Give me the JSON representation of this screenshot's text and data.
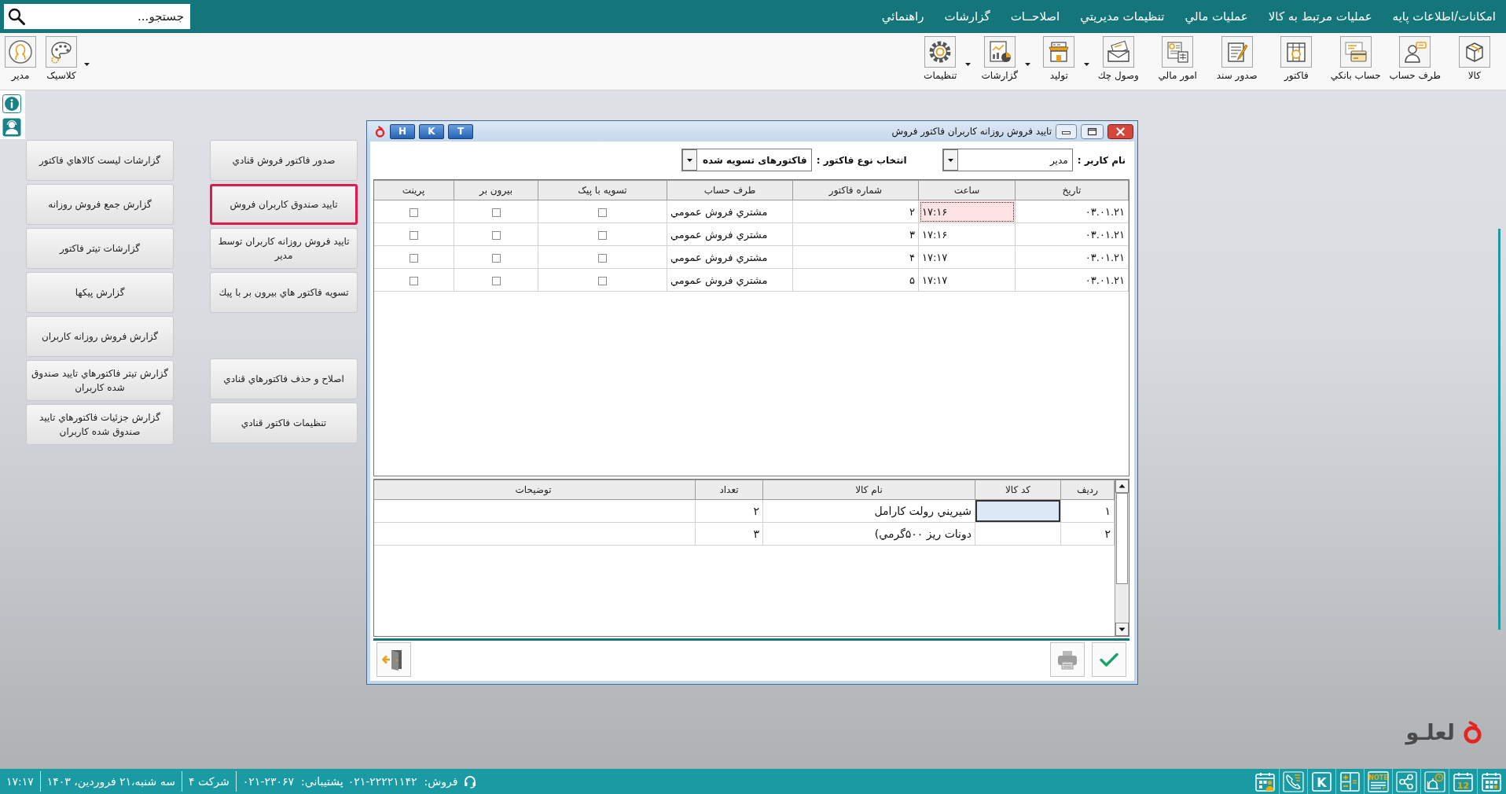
{
  "menu_bar": {
    "items": [
      {
        "label": "امکانات/اطلاعات پايه"
      },
      {
        "label": "عمليات مرتبط به کالا"
      },
      {
        "label": "عمليات مالي"
      },
      {
        "label": "تنظيمات مديريتي"
      },
      {
        "label": "اصلاحــات"
      },
      {
        "label": "گزارشات"
      },
      {
        "label": "راهنمائي"
      }
    ],
    "search": {
      "placeholder": "جستجو..."
    }
  },
  "toolbar": {
    "items": [
      {
        "label": "کالا",
        "dropdown": false
      },
      {
        "label": "طرف حساب",
        "dropdown": false
      },
      {
        "label": "حساب بانکي",
        "dropdown": false
      },
      {
        "label": "فاکتور",
        "dropdown": false
      },
      {
        "label": "صدور سند",
        "dropdown": false
      },
      {
        "label": "امور مالي",
        "dropdown": false
      },
      {
        "label": "وصول چك",
        "dropdown": false
      },
      {
        "label": "توليد",
        "dropdown": true
      },
      {
        "label": "گزارشات",
        "dropdown": true
      },
      {
        "label": "تنظيمات",
        "dropdown": true
      }
    ],
    "user_items": [
      {
        "label": "کلاسيک",
        "dropdown": true
      },
      {
        "label": "مدير",
        "dropdown": false
      }
    ]
  },
  "action_panel": {
    "columns": [
      {
        "groups": [
          [
            {
              "label": "صدور فاکتور فروش قنادي",
              "selected": false
            },
            {
              "label": "تاييد صندوق کاربران فروش",
              "selected": true
            },
            {
              "label": "تاييد فروش روزانه کاربران توسط مدير",
              "selected": false
            },
            {
              "label": "تسويه فاکتور هاي بيرون بر با پيك",
              "selected": false
            }
          ],
          [
            {
              "label": "اصلاح و حذف فاکتورهاي قنادي",
              "selected": false
            },
            {
              "label": "تنظيمات فاکتور قنادي",
              "selected": false
            }
          ]
        ]
      },
      {
        "groups": [
          [
            {
              "label": "گزارشات ليست کالاهاي فاکتور",
              "selected": false
            },
            {
              "label": "گزارش جمع فروش روزانه",
              "selected": false
            },
            {
              "label": "گزارشات تيتر فاکتور",
              "selected": false
            },
            {
              "label": "گزارش پيکها",
              "selected": false
            },
            {
              "label": "گزارش فروش روزانه کاربران",
              "selected": false
            },
            {
              "label": "گزارش تيتر فاکتورهاي تاييد صندوق شده کاربران",
              "selected": false
            },
            {
              "label": "گزارش جزئيات فاکتورهاي تاييد صندوق شده کاربران",
              "selected": false
            }
          ]
        ]
      }
    ]
  },
  "dialog": {
    "title": "تاييد فروش روزانه کاربران فاکتور فروش",
    "title_buttons": [
      {
        "label": "T"
      },
      {
        "label": "K"
      },
      {
        "label": "H"
      }
    ],
    "filters": [
      {
        "label": "نام کاربر :",
        "value": "مدير"
      },
      {
        "label": "انتخاب نوع فاکتور :",
        "value": "فاکتورهای تسويه شده"
      }
    ],
    "invoices": {
      "columns": [
        "تاريخ",
        "ساعت",
        "شماره فاکتور",
        "طرف حساب",
        "تسويه با پيک",
        "بيرون بر",
        "پرينت"
      ],
      "rows": [
        {
          "date": "۰۳.۰۱.۲۱",
          "time": "۱۷:۱۶",
          "number": "۲",
          "account": "مشتري فروش عمومي",
          "courier_settled": false,
          "takeaway": false,
          "print": false,
          "selected": true
        },
        {
          "date": "۰۳.۰۱.۲۱",
          "time": "۱۷:۱۶",
          "number": "۳",
          "account": "مشتري فروش عمومي",
          "courier_settled": false,
          "takeaway": false,
          "print": false,
          "selected": false
        },
        {
          "date": "۰۳.۰۱.۲۱",
          "time": "۱۷:۱۷",
          "number": "۴",
          "account": "مشتري فروش عمومي",
          "courier_settled": false,
          "takeaway": false,
          "print": false,
          "selected": false
        },
        {
          "date": "۰۳.۰۱.۲۱",
          "time": "۱۷:۱۷",
          "number": "۵",
          "account": "مشتري فروش عمومي",
          "courier_settled": false,
          "takeaway": false,
          "print": false,
          "selected": false
        }
      ]
    },
    "items": {
      "columns": [
        "رديف",
        "کد کالا",
        "نام کالا",
        "تعداد",
        "توضيحات"
      ],
      "rows": [
        {
          "row_no": "۱",
          "name": "شيريني رولت کارامل",
          "qty": "۲",
          "selected": true
        },
        {
          "row_no": "۲",
          "name": "دونات ريز ۵۰۰گرمي)",
          "qty": "۳",
          "selected": false
        }
      ]
    }
  },
  "logo": {
    "text": "لعلـو"
  },
  "status_bar": {
    "shortcuts": [
      {
        "kind": "planner"
      },
      {
        "kind": "calendar",
        "text": "12"
      },
      {
        "kind": "clock"
      },
      {
        "kind": "share"
      },
      {
        "kind": "note",
        "text": "NOTE"
      },
      {
        "kind": "calculator"
      },
      {
        "kind": "key",
        "text": "K"
      },
      {
        "kind": "phone"
      },
      {
        "kind": "schedule"
      }
    ],
    "contacts": [
      {
        "label": "فروش:",
        "phone": "۰۲۱-۲۲۲۲۱۱۴۲"
      },
      {
        "label": "پشتيباني:",
        "phone": "۰۲۱-۲۳۰۶۷"
      }
    ],
    "company": "شرکت ۴",
    "date": "سه شنبه،۲۱ فروردين، ۱۴۰۳",
    "time": "۱۷:۱۷"
  }
}
